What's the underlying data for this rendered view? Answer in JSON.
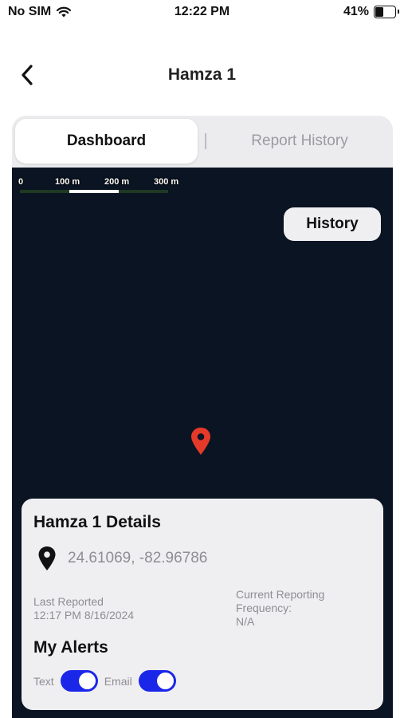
{
  "status_bar": {
    "carrier": "No SIM",
    "time": "12:22 PM",
    "battery": "41%",
    "battery_level": 0.41
  },
  "header": {
    "title": "Hamza 1"
  },
  "tabs": [
    {
      "label": "Dashboard",
      "active": true
    },
    {
      "label": "Report History",
      "active": false
    }
  ],
  "map": {
    "scale_labels": [
      "0",
      "100 m",
      "200 m",
      "300 m"
    ],
    "history_label": "History",
    "pin_color": "#e53a2a"
  },
  "details": {
    "title": "Hamza 1 Details",
    "coordinates": "24.61069, -82.96786",
    "last_reported_label": "Last Reported",
    "last_reported_value": "12:17 PM 8/16/2024",
    "frequency_label": "Current Reporting Frequency:",
    "frequency_value": "N/A"
  },
  "alerts": {
    "title": "My Alerts",
    "text_label": "Text",
    "email_label": "Email",
    "text_enabled": true,
    "email_enabled": true,
    "toggle_color": "#1b27e8"
  }
}
